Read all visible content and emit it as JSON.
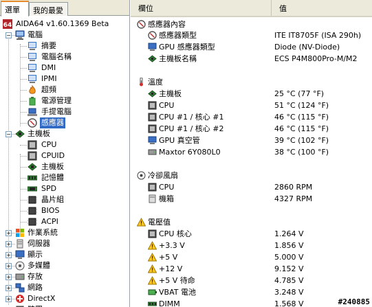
{
  "tabs": [
    "選單",
    "我的最愛"
  ],
  "tree": {
    "root_label": "AIDA64 v1.60.1369 Beta",
    "computer": {
      "label": "電腦",
      "children": [
        "摘要",
        "電腦名稱",
        "DMI",
        "IPMI",
        "超頻",
        "電源管理",
        "手提電腦",
        "感應器"
      ]
    },
    "motherboard": {
      "label": "主機板",
      "children": [
        "CPU",
        "CPUID",
        "主機板",
        "記憶體",
        "SPD",
        "晶片組",
        "BIOS",
        "ACPI"
      ]
    },
    "others": [
      "作業系統",
      "伺服器",
      "顯示",
      "多媒體",
      "存放",
      "網路",
      "DirectX",
      "裝置"
    ]
  },
  "columns": {
    "field": "欄位",
    "value": "值"
  },
  "sections": [
    {
      "title": "感應器內容",
      "rows": [
        {
          "label": "感應器類型",
          "value": "ITE IT8705F  (ISA 290h)",
          "icon": "sensor-icon"
        },
        {
          "label": "GPU 感應器類型",
          "value": "Diode  (NV-Diode)",
          "icon": "gpu-icon"
        },
        {
          "label": "主機板名稱",
          "value": "ECS P4M800Pro-M/M2",
          "icon": "motherboard-icon"
        }
      ]
    },
    {
      "title": "溫度",
      "rows": [
        {
          "label": "主機板",
          "value": "25 °C  (77 °F)",
          "icon": "motherboard-icon"
        },
        {
          "label": "CPU",
          "value": "51 °C  (124 °F)",
          "icon": "cpu-icon"
        },
        {
          "label": "CPU #1 / 核心 #1",
          "value": "46 °C  (115 °F)",
          "icon": "cpu-icon"
        },
        {
          "label": "CPU #1 / 核心 #2",
          "value": "46 °C  (115 °F)",
          "icon": "cpu-icon"
        },
        {
          "label": "GPU 真空管",
          "value": "39 °C  (102 °F)",
          "icon": "gpu-icon"
        },
        {
          "label": "Maxtor 6Y080L0",
          "value": "38 °C  (100 °F)",
          "icon": "disk-icon"
        }
      ]
    },
    {
      "title": "冷卻風扇",
      "rows": [
        {
          "label": "CPU",
          "value": "2860 RPM",
          "icon": "cpu-icon"
        },
        {
          "label": "機箱",
          "value": "4327 RPM",
          "icon": "chassis-icon"
        }
      ]
    },
    {
      "title": "電壓值",
      "rows": [
        {
          "label": "CPU 核心",
          "value": "1.264 V",
          "icon": "cpu-icon"
        },
        {
          "label": "+3.3 V",
          "value": "1.856 V",
          "icon": "warning-icon"
        },
        {
          "label": "+5 V",
          "value": "5.000 V",
          "icon": "warning-icon"
        },
        {
          "label": "+12 V",
          "value": "9.152 V",
          "icon": "warning-icon"
        },
        {
          "label": "+5 V 待命",
          "value": "4.785 V",
          "icon": "warning-icon"
        },
        {
          "label": "VBAT 電池",
          "value": "3.248 V",
          "icon": "battery-icon"
        },
        {
          "label": "DIMM",
          "value": "1.568 V",
          "icon": "memory-icon"
        }
      ]
    }
  ],
  "watermark": "#240885"
}
